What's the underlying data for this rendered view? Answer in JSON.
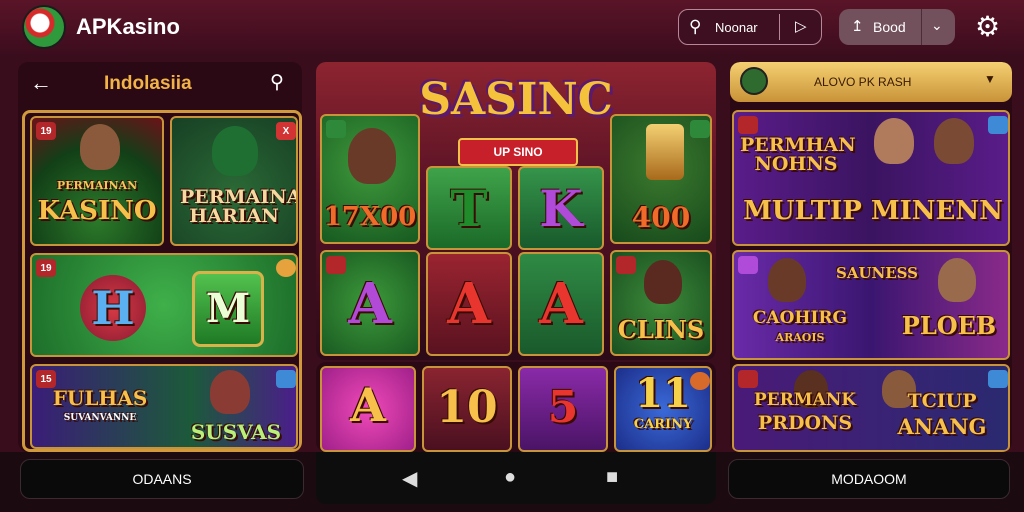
{
  "header": {
    "brand": "APKasino",
    "search_text": "Noonar",
    "account_label": "Bood"
  },
  "left_panel": {
    "title": "Indolasiia",
    "tiles": [
      {
        "badge": "19",
        "text": "KASINO",
        "sub": "PERMAINAN"
      },
      {
        "badge": "X",
        "text": "PERMAINAN HARIAN"
      },
      {
        "badge": "19",
        "text": "H",
        "text2": "M"
      },
      {
        "badge": "15",
        "text": "FULHAS",
        "sub": "SUVANVANNE",
        "text2": "SUSVAS"
      }
    ]
  },
  "center_panel": {
    "title": "SASINC",
    "subtitle": "UP SINO",
    "tiles": [
      {
        "text": "17X00"
      },
      {
        "text": "T"
      },
      {
        "text": "K"
      },
      {
        "text": "400"
      },
      {
        "text": "A"
      },
      {
        "text": "A"
      },
      {
        "text": "A"
      },
      {
        "text": "CLINS"
      },
      {
        "text": "A"
      },
      {
        "text": "10"
      },
      {
        "text": "5"
      },
      {
        "text": "11",
        "sub": "CARINY"
      }
    ]
  },
  "right_panel": {
    "pill_label": "ALOVO PK RASH",
    "tiles": [
      {
        "text": "PERMHAN NOHNS",
        "text2": "MULTIP MINENN"
      },
      {
        "text": "SAUNESS",
        "text2": "CAOHIRG",
        "text3": "PLOEB",
        "sub": "ARAOIS"
      },
      {
        "text": "PERMANK",
        "text2": "PRDONS",
        "text3": "TCIUP",
        "text4": "ANANG"
      }
    ]
  },
  "bottom": {
    "left_button": "ODAANS",
    "right_button": "MODAOOM"
  },
  "colors": {
    "background": "#3a0d1d",
    "gold": "#f2b347",
    "green": "#2e9a3c",
    "purple": "#7a2aa8"
  }
}
